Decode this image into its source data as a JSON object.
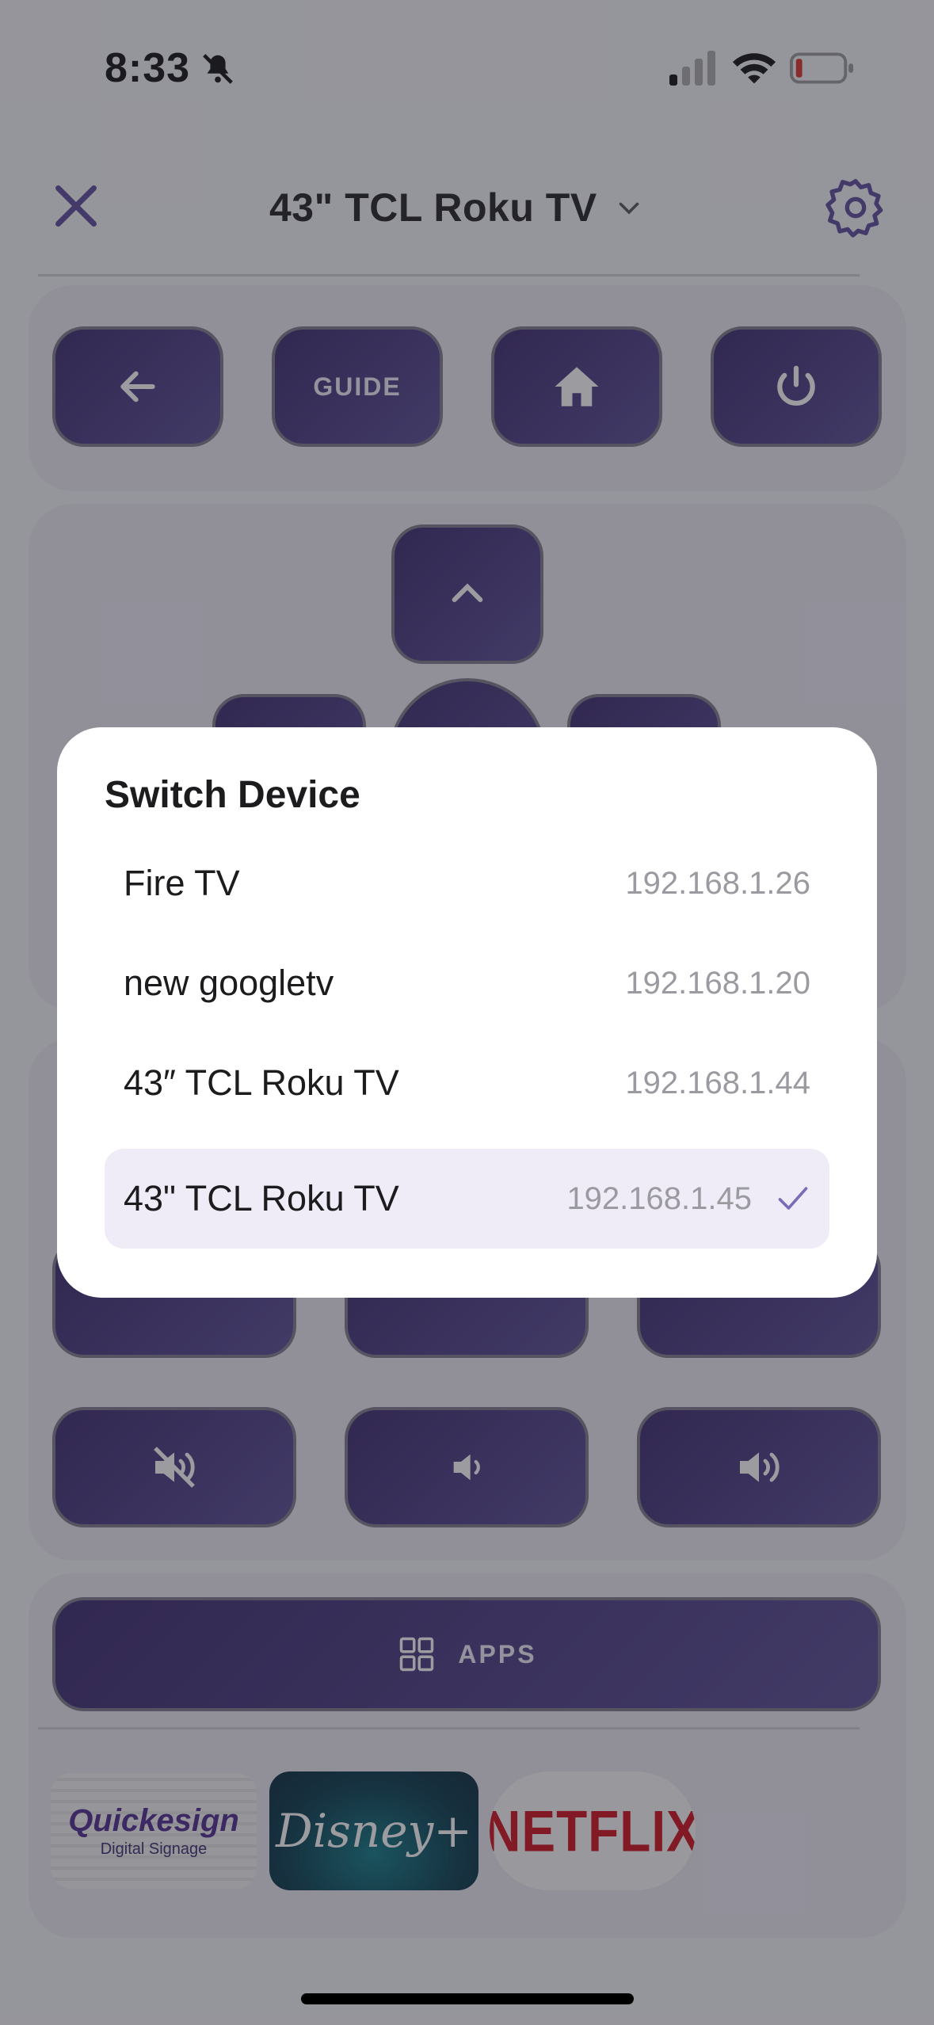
{
  "status_bar": {
    "time": "8:33",
    "icons": [
      "bell-slash-icon",
      "cellular-signal-icon",
      "wifi-icon",
      "battery-low-icon"
    ]
  },
  "header": {
    "close_icon": "close-icon",
    "device_title": "43\" TCL Roku TV",
    "dropdown_icon": "chevron-down-icon",
    "settings_icon": "gear-icon"
  },
  "remote": {
    "top_row": [
      {
        "name": "back",
        "icon": "arrow-left-icon"
      },
      {
        "name": "guide",
        "label": "GUIDE"
      },
      {
        "name": "home",
        "icon": "home-icon"
      },
      {
        "name": "power",
        "icon": "power-icon"
      }
    ],
    "volume_row": [
      {
        "name": "mute",
        "icon": "volume-mute-icon"
      },
      {
        "name": "volume-down",
        "icon": "volume-down-icon"
      },
      {
        "name": "volume-up",
        "icon": "volume-up-icon"
      }
    ],
    "apps_button_label": "APPS",
    "apps_icon": "grid-icon"
  },
  "app_tiles": [
    {
      "name": "Quickesign",
      "title": "Quickesign",
      "subtitle": "Digital Signage"
    },
    {
      "name": "Disney+",
      "title": "Disney+"
    },
    {
      "name": "Netflix",
      "title": "NETFLIX"
    }
  ],
  "modal": {
    "title": "Switch Device",
    "devices": [
      {
        "name": "Fire TV",
        "ip": "192.168.1.26",
        "selected": false
      },
      {
        "name": "new googletv",
        "ip": "192.168.1.20",
        "selected": false
      },
      {
        "name": "43″ TCL Roku TV",
        "ip": "192.168.1.44",
        "selected": false
      },
      {
        "name": "43\" TCL Roku TV",
        "ip": "192.168.1.45",
        "selected": true
      }
    ]
  },
  "colors": {
    "accent": "#5b4b9a",
    "button_dark": "#3b2a6e",
    "button_light": "#594c95",
    "selected_row": "#efecf8",
    "netflix_red": "#d0101e"
  }
}
